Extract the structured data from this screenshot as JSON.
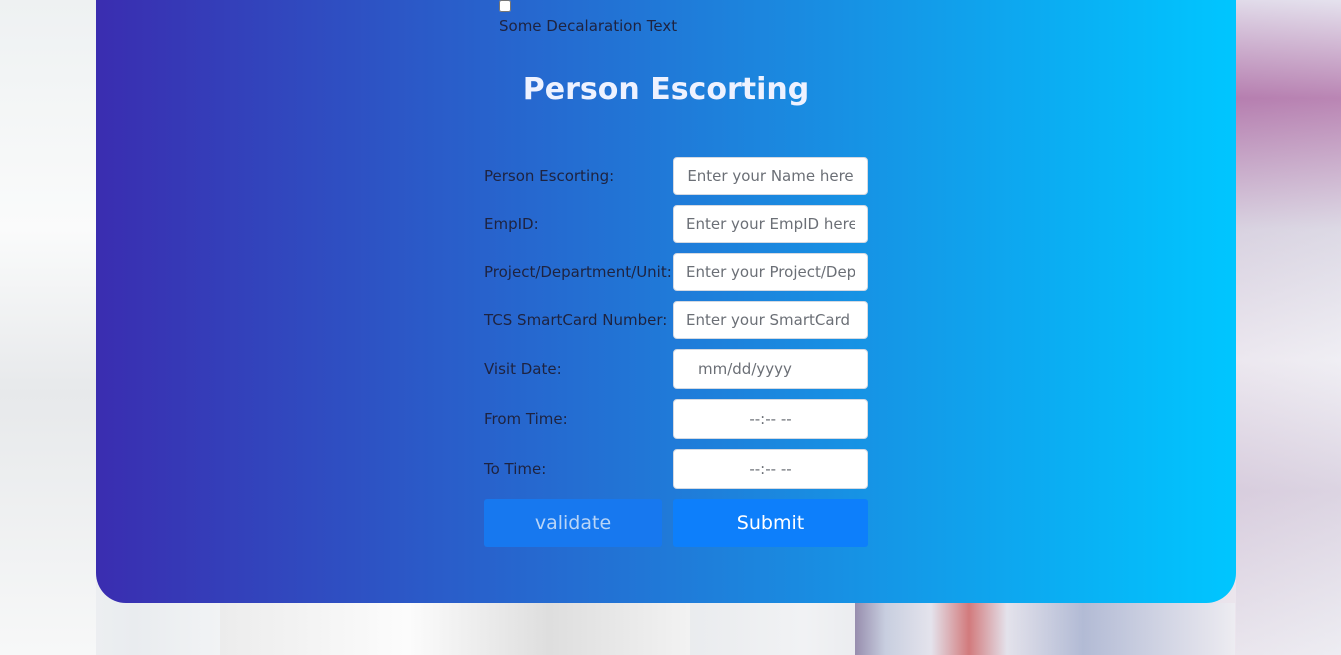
{
  "declaration": {
    "checked": false,
    "text": "Some Decalaration Text"
  },
  "form": {
    "title": "Person Escorting",
    "fields": [
      {
        "label": "Person Escorting:",
        "placeholder": "Enter your Name here",
        "value": ""
      },
      {
        "label": "EmpID:",
        "placeholder": "Enter your EmpID here",
        "value": ""
      },
      {
        "label": "Project/Department/Unit:",
        "placeholder": "Enter your Project/Department/Unit here",
        "value": ""
      },
      {
        "label": "TCS SmartCard Number:",
        "placeholder": "Enter your SmartCard Number here",
        "value": ""
      },
      {
        "label": "Visit Date:",
        "placeholder": "mm/dd/yyyy",
        "value": ""
      },
      {
        "label": "From Time:",
        "placeholder": "--:-- --",
        "value": ""
      },
      {
        "label": "To Time:",
        "placeholder": "--:-- --",
        "value": ""
      }
    ],
    "buttons": {
      "validate": "validate",
      "submit": "Submit"
    }
  },
  "colors": {
    "gradient_start": "#3a2db0",
    "gradient_end": "#00c6ff",
    "submit_button": "#0d7ffb",
    "validate_button": "#1778ef"
  }
}
